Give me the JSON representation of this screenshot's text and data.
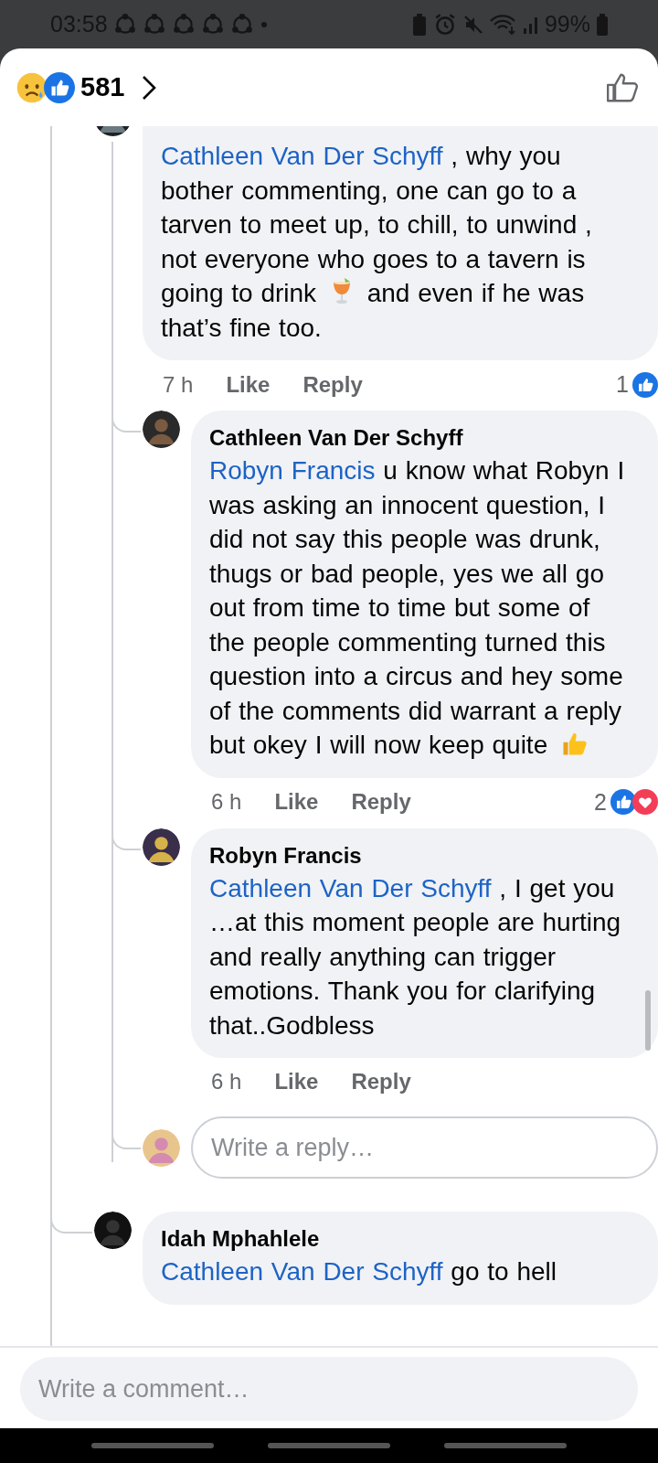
{
  "status_bar": {
    "time": "03:58",
    "battery": "99%"
  },
  "header": {
    "reactions": [
      {
        "kind": "sad"
      },
      {
        "kind": "like"
      }
    ],
    "count": "581"
  },
  "comments": [
    {
      "body": [
        {
          "kind": "mention",
          "text": "Cathleen Van Der Schyff"
        },
        {
          "kind": "text",
          "text": " , why you bother commenting, one can go to a tarven to meet up, to chill, to unwind , not everyone who goes to a tavern is going to drink "
        },
        {
          "kind": "drink"
        },
        {
          "kind": "text",
          "text": " and even if he was that’s fine too."
        }
      ],
      "time": "7 h",
      "like": "Like",
      "reply": "Reply",
      "reaction_count": "1",
      "reactions": [
        {
          "kind": "like"
        }
      ],
      "replies": [
        {
          "author": "Cathleen Van Der Schyff",
          "body": [
            {
              "kind": "mention",
              "text": "Robyn Francis"
            },
            {
              "kind": "text",
              "text": " u know what Robyn I was asking an innocent question, I did not say this people was drunk, thugs or bad people, yes we all go out from time to time but some of the people commenting turned this question into a circus and hey some of the comments did warrant a reply but okey I will now keep quite "
            },
            {
              "kind": "thumbs_up"
            }
          ],
          "time": "6 h",
          "like": "Like",
          "reply": "Reply",
          "reaction_count": "2",
          "reactions": [
            {
              "kind": "like"
            },
            {
              "kind": "love"
            }
          ]
        },
        {
          "author": "Robyn Francis",
          "body": [
            {
              "kind": "mention",
              "text": "Cathleen Van Der Schyff"
            },
            {
              "kind": "text",
              "text": " , I get you …at this moment people are hurting and really anything can trigger emotions. Thank you for clarifying that..Godbless"
            }
          ],
          "time": "6 h",
          "like": "Like",
          "reply": "Reply"
        }
      ],
      "reply_box": {
        "placeholder": "Write a reply…"
      }
    },
    {
      "author": "Idah Mphahlele",
      "body": [
        {
          "kind": "mention",
          "text": "Cathleen Van Der Schyff"
        },
        {
          "kind": "text",
          "text": " go to hell"
        }
      ]
    }
  ],
  "composer": {
    "placeholder": "Write a comment…"
  }
}
